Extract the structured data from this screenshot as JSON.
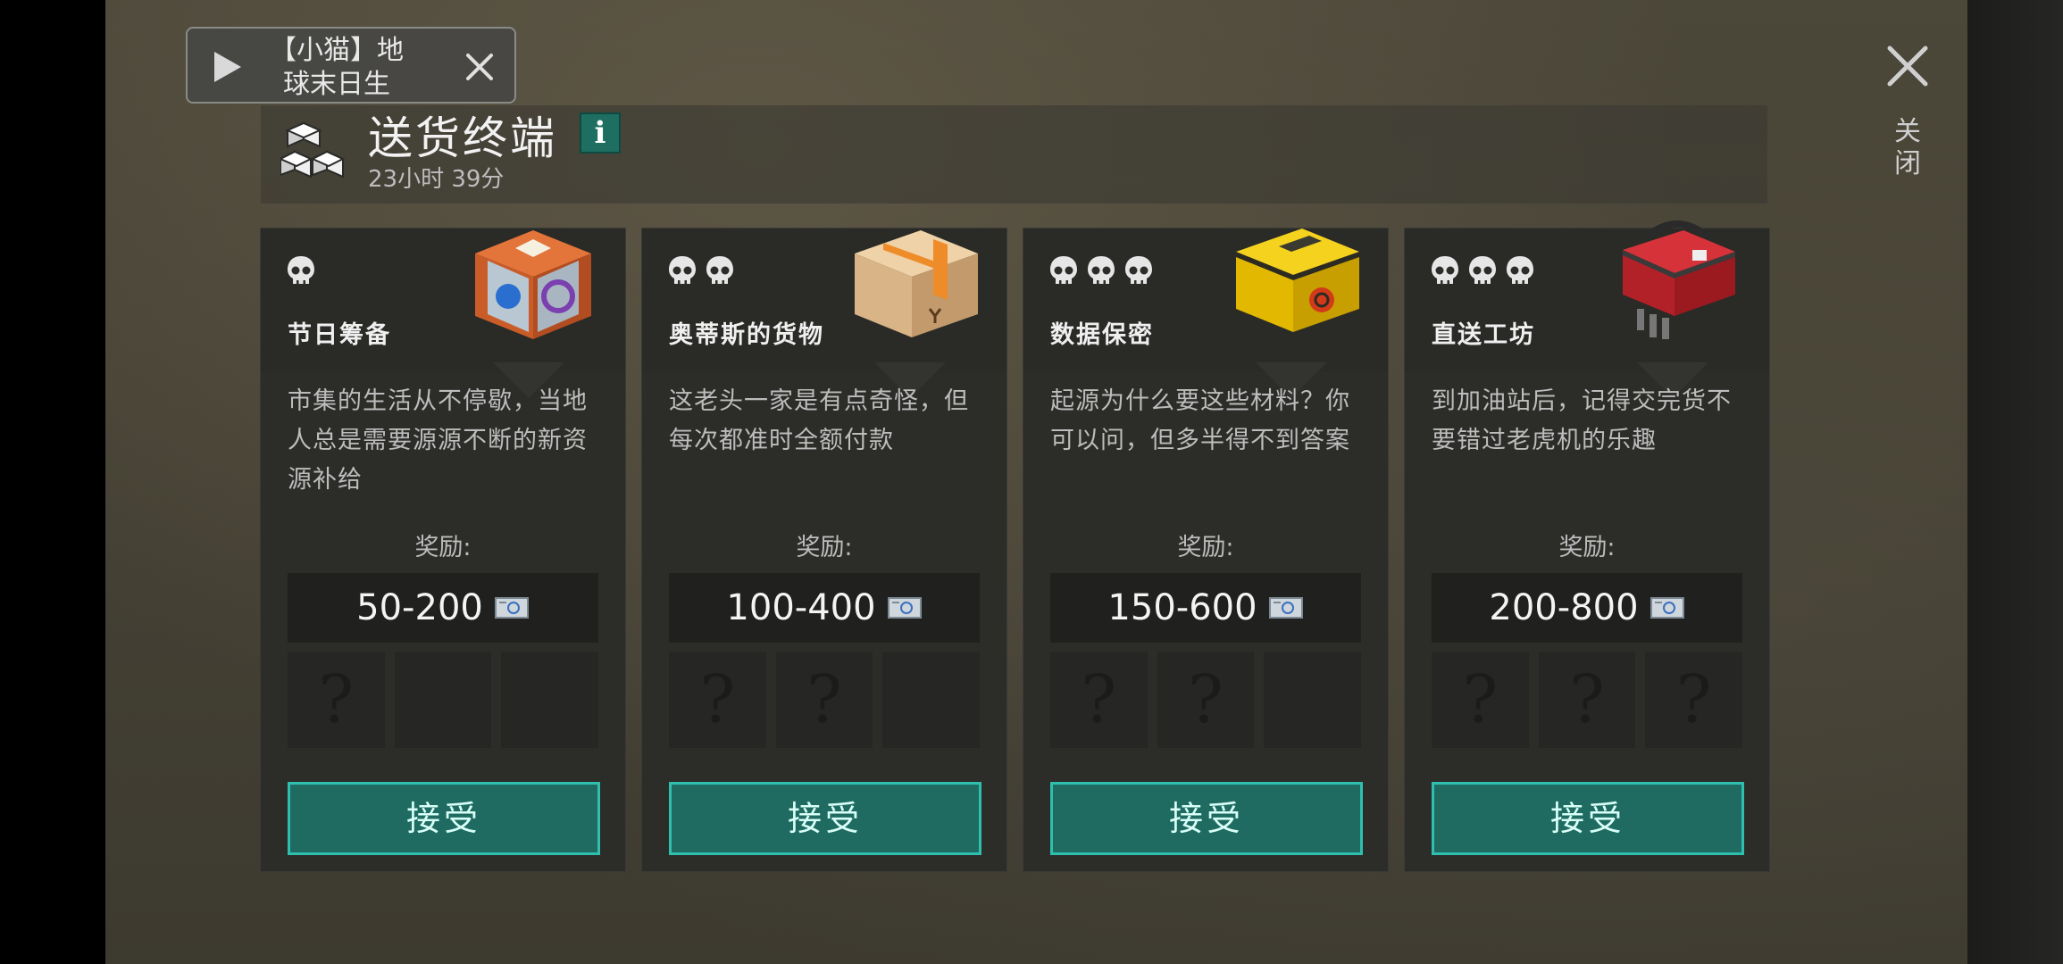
{
  "floating_widget": {
    "title": "【小猫】地球末日生"
  },
  "close": {
    "label": "关闭"
  },
  "header": {
    "title": "送货终端",
    "info": "i",
    "timer": "23小时 39分"
  },
  "cards": [
    {
      "name": "节日筹备",
      "difficulty_skulls": 1,
      "crate_icon": "festival-crate-icon",
      "description": "市集的生活从不停歇，当地人总是需要源源不断的新资源补给",
      "reward_label": "奖励:",
      "reward_value": "50-200",
      "reward_icon": "ticket-icon",
      "unknown_slots": 1,
      "slot_symbol": "?",
      "accept_label": "接受"
    },
    {
      "name": "奥蒂斯的货物",
      "difficulty_skulls": 2,
      "crate_icon": "cardboard-box-icon",
      "description": "这老头一家是有点奇怪，但每次都准时全额付款",
      "reward_label": "奖励:",
      "reward_value": "100-400",
      "reward_icon": "ticket-icon",
      "unknown_slots": 2,
      "slot_symbol": "?",
      "accept_label": "接受"
    },
    {
      "name": "数据保密",
      "difficulty_skulls": 3,
      "crate_icon": "biohazard-case-icon",
      "description": "起源为什么要这些材料？你可以问，但多半得不到答案",
      "reward_label": "奖励:",
      "reward_value": "150-600",
      "reward_icon": "ticket-icon",
      "unknown_slots": 2,
      "slot_symbol": "?",
      "accept_label": "接受"
    },
    {
      "name": "直送工坊",
      "difficulty_skulls": 3,
      "crate_icon": "toolbox-icon",
      "description": "到加油站后，记得交完货不要错过老虎机的乐趣",
      "reward_label": "奖励:",
      "reward_value": "200-800",
      "reward_icon": "ticket-icon",
      "unknown_slots": 3,
      "slot_symbol": "?",
      "accept_label": "接受"
    }
  ],
  "colors": {
    "accent": "#1f6b61",
    "accent_border": "#2fbfae",
    "card_bg": "#2c2c29"
  }
}
